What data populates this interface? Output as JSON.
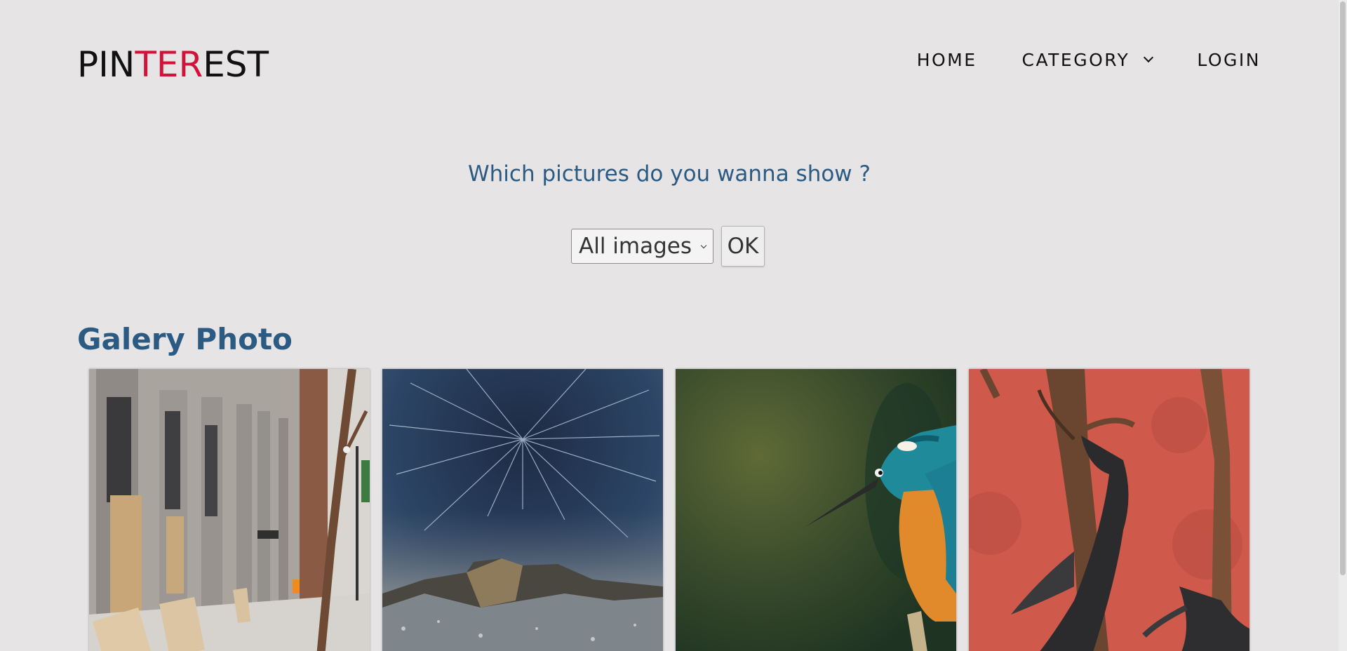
{
  "brand": {
    "logo_start": "PIN",
    "logo_middle": "TER",
    "logo_end": "EST",
    "accent_color": "#d11339"
  },
  "nav": {
    "home": "HOME",
    "category": "CATEGORY",
    "login": "LOGIN"
  },
  "filter": {
    "question": "Which pictures do you wanna show ?",
    "select_value": "All images",
    "ok_label": "OK"
  },
  "gallery": {
    "title": "Galery Photo",
    "photos": [
      {
        "subject": "city-street-building"
      },
      {
        "subject": "star-trails-over-mountain"
      },
      {
        "subject": "kingfisher-bird"
      },
      {
        "subject": "bats-on-branch-red-wall"
      }
    ]
  },
  "colors": {
    "background": "#e6e4e5",
    "heading": "#2b5a82"
  }
}
